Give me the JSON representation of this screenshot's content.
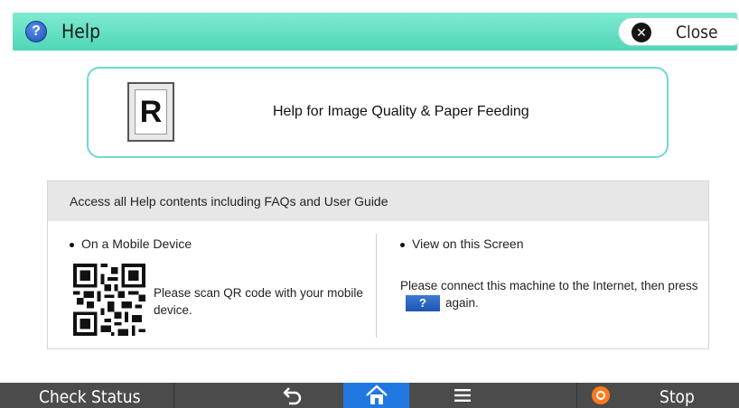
{
  "header": {
    "title": "Help",
    "help_icon_glyph": "?",
    "close_label": "Close",
    "close_icon_glyph": "✕",
    "accent_color": "#4fd7b6"
  },
  "main_option": {
    "icon_letter": "R",
    "label": "Help for Image Quality & Paper Feeding"
  },
  "info": {
    "header": "Access all Help contents including FAQs and User Guide",
    "mobile_title": "On a Mobile Device",
    "mobile_text": "Please scan QR code with your mobile device.",
    "screen_title": "View on this Screen",
    "screen_text_before": "Please connect this machine to the Internet, then press",
    "help_button_glyph": "?",
    "screen_text_after": "again."
  },
  "bottom_bar": {
    "check_status": "Check Status",
    "back_icon": "back-arrow-icon",
    "home_icon": "home-icon",
    "menu_icon": "menu-icon",
    "stop_label": "Stop",
    "home_active_color": "#2178e0",
    "stop_color": "#ff7a1e"
  }
}
